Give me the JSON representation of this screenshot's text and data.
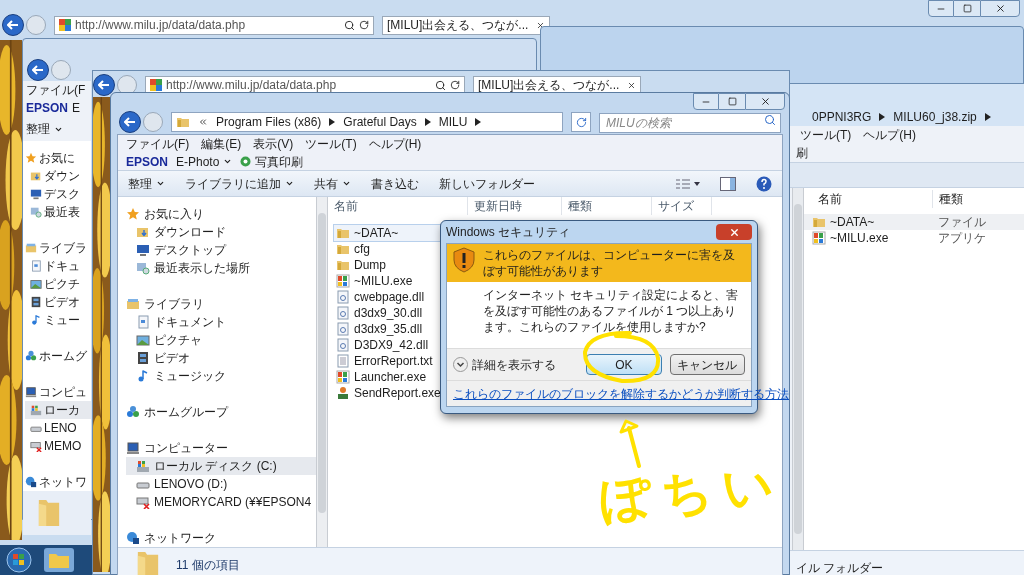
{
  "back_browser": {
    "address": "http://www.milu.jp/data/data.php",
    "tab": "[MILU]出会える、つなが..."
  },
  "back_explorer": {
    "menu": "ファイル(F",
    "brand": "EPSON",
    "app": "E",
    "command": "整理",
    "sidebar": [
      {
        "label": "お気に",
        "kind": "star",
        "children": [
          {
            "label": "ダウン",
            "kind": "download",
            "selected": false
          },
          {
            "label": "デスク",
            "kind": "desktop",
            "selected": false
          },
          {
            "label": "最近表",
            "kind": "recent",
            "selected": false
          }
        ]
      },
      {
        "label": "ライブラ",
        "kind": "library",
        "children": [
          {
            "label": "ドキュ",
            "kind": "document",
            "selected": false
          },
          {
            "label": "ピクチ",
            "kind": "picture",
            "selected": false
          },
          {
            "label": "ビデオ",
            "kind": "video",
            "selected": false
          },
          {
            "label": "ミュー",
            "kind": "music",
            "selected": false
          }
        ]
      },
      {
        "label": "ホームグ",
        "kind": "homegroup"
      },
      {
        "label": "コンピュ",
        "kind": "computer",
        "children": [
          {
            "label": "ローカ",
            "kind": "disk",
            "selected": true
          },
          {
            "label": "LENO",
            "kind": "drive",
            "selected": false
          },
          {
            "label": "MEMO",
            "kind": "card",
            "selected": false
          }
        ]
      },
      {
        "label": "ネットワ",
        "kind": "network"
      }
    ]
  },
  "middle_browser": {
    "address": "http://www.milu.jp/data/data.php",
    "tab": "[MILU]出会える、つなが..."
  },
  "right_explorer": {
    "breadcrumb": [
      "0PPNI3RG",
      "MILU60_j38.zip"
    ],
    "menus": [
      "ツール(T)",
      "ヘルプ(H)"
    ],
    "toolbar_fragment": "刷",
    "columns": [
      "名前",
      "種類"
    ],
    "rows": [
      {
        "name": "~DATA~",
        "type": "ファイル",
        "kind": "folder",
        "selected": true
      },
      {
        "name": "~MILU.exe",
        "type": "アプリケ",
        "kind": "app",
        "selected": false
      }
    ],
    "status": "イル フォルダー"
  },
  "explorer": {
    "breadcrumb": [
      "Program Files (x86)",
      "Grateful Days",
      "MILU"
    ],
    "search": {
      "placeholder": "MILUの検索"
    },
    "menus": [
      "ファイル(F)",
      "編集(E)",
      "表示(V)",
      "ツール(T)",
      "ヘルプ(H)"
    ],
    "epson": {
      "brand": "EPSON",
      "app": "E-Photo",
      "print": "写真印刷"
    },
    "commands": [
      {
        "label": "整理",
        "dropdown": true
      },
      {
        "label": "ライブラリに追加",
        "dropdown": true
      },
      {
        "label": "共有",
        "dropdown": true
      },
      {
        "label": "書き込む",
        "dropdown": false
      },
      {
        "label": "新しいフォルダー",
        "dropdown": false
      }
    ],
    "sidebar": [
      {
        "label": "お気に入り",
        "kind": "star",
        "children": [
          {
            "label": "ダウンロード",
            "kind": "download",
            "selected": false
          },
          {
            "label": "デスクトップ",
            "kind": "desktop",
            "selected": false
          },
          {
            "label": "最近表示した場所",
            "kind": "recent",
            "selected": false
          }
        ]
      },
      {
        "label": "ライブラリ",
        "kind": "library",
        "children": [
          {
            "label": "ドキュメント",
            "kind": "document",
            "selected": false
          },
          {
            "label": "ピクチャ",
            "kind": "picture",
            "selected": false
          },
          {
            "label": "ビデオ",
            "kind": "video",
            "selected": false
          },
          {
            "label": "ミュージック",
            "kind": "music",
            "selected": false
          }
        ]
      },
      {
        "label": "ホームグループ",
        "kind": "homegroup"
      },
      {
        "label": "コンピューター",
        "kind": "computer",
        "children": [
          {
            "label": "ローカル ディスク (C:)",
            "kind": "disk",
            "selected": true
          },
          {
            "label": "LENOVO (D:)",
            "kind": "drive",
            "selected": false
          },
          {
            "label": "MEMORYCARD (¥¥EPSON4",
            "kind": "card",
            "selected": false
          }
        ]
      },
      {
        "label": "ネットワーク",
        "kind": "network"
      }
    ],
    "columns": [
      "名前",
      "更新日時",
      "種類",
      "サイズ"
    ],
    "files": [
      {
        "name": "~DATA~",
        "kind": "folder",
        "selected": true
      },
      {
        "name": "cfg",
        "kind": "folder",
        "selected": false
      },
      {
        "name": "Dump",
        "kind": "folder",
        "selected": false
      },
      {
        "name": "~MILU.exe",
        "kind": "app",
        "selected": false
      },
      {
        "name": "cwebpage.dll",
        "kind": "dll",
        "selected": false
      },
      {
        "name": "d3dx9_30.dll",
        "kind": "dll",
        "selected": false
      },
      {
        "name": "d3dx9_35.dll",
        "kind": "dll",
        "selected": false
      },
      {
        "name": "D3DX9_42.dll",
        "kind": "dll",
        "selected": false
      },
      {
        "name": "ErrorReport.txt",
        "kind": "text",
        "selected": false
      },
      {
        "name": "Launcher.exe",
        "kind": "app",
        "selected": false
      },
      {
        "name": "SendReport.exe",
        "kind": "sender",
        "selected": false
      }
    ],
    "status": "11 個の項目"
  },
  "dialog": {
    "title": "Windows セキュリティ",
    "warning": "これらのファイルは、コンピューターに害を及ぼす可能性があります",
    "body": "インターネット セキュリティ設定によると、害を及ぼす可能性のあるファイルが 1 つ以上あります。これらのファイルを使用しますか?",
    "details": "詳細を表示する",
    "buttons": [
      {
        "label": "OK",
        "selected": true
      },
      {
        "label": "キャンセル",
        "selected": false
      }
    ],
    "link": "これらのファイルのブロックを解除するかどうか判断する方法"
  },
  "annotation": {
    "text": "ぽちい"
  }
}
